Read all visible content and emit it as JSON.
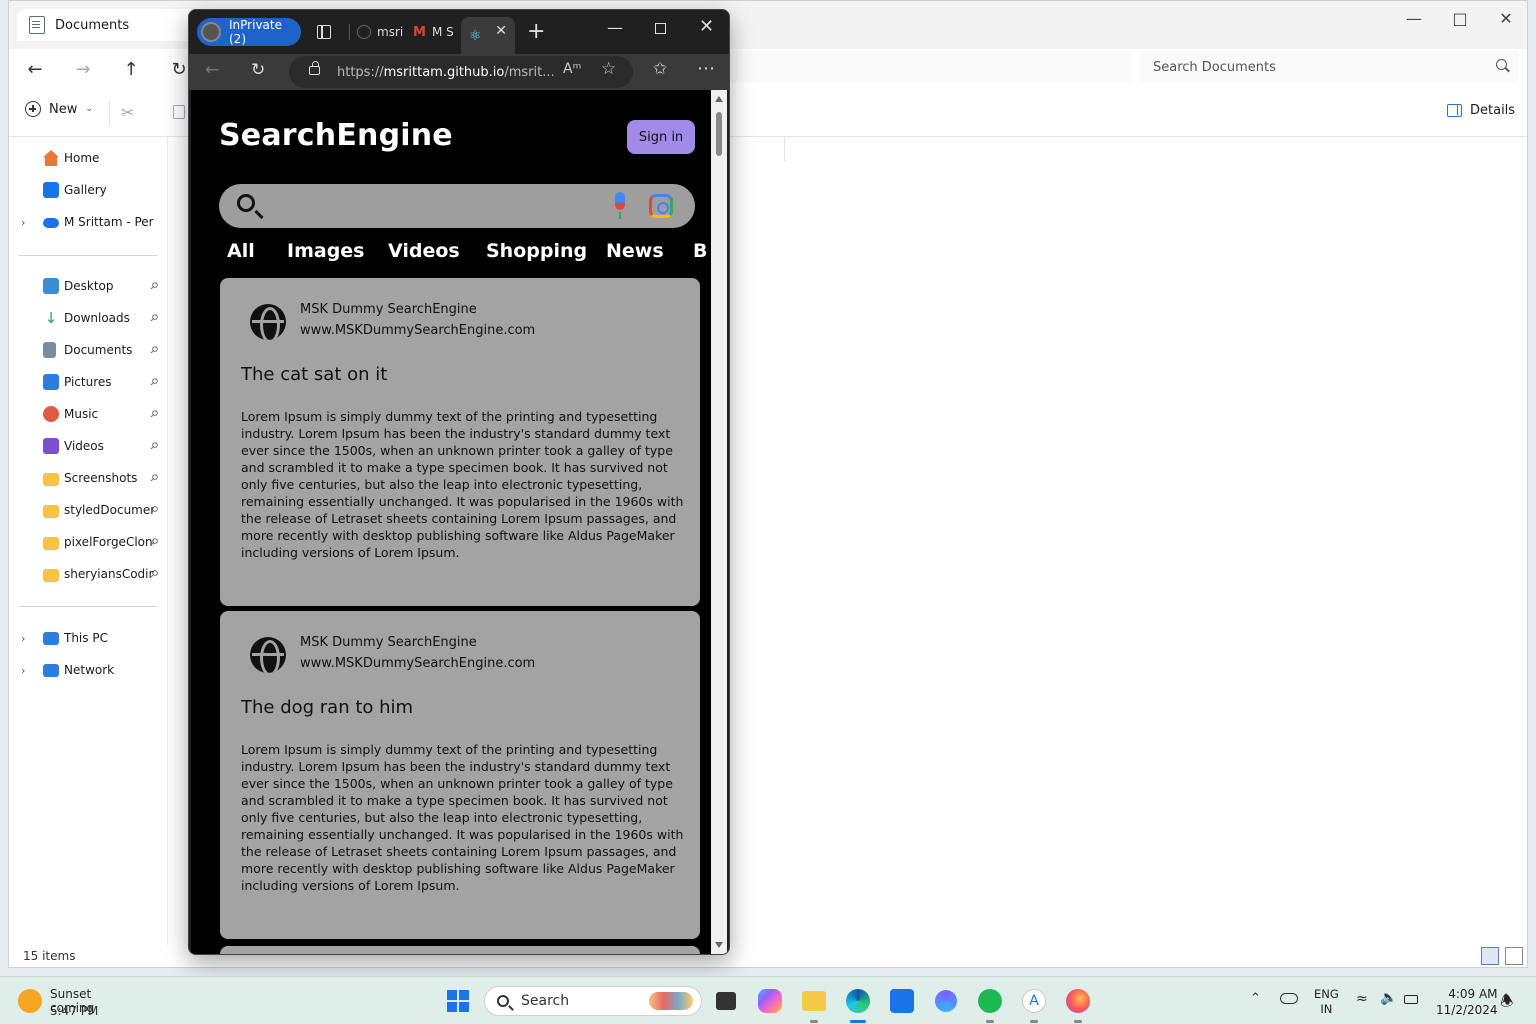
{
  "explorer": {
    "tab_title": "Documents",
    "search_placeholder": "Search Documents",
    "toolbar": {
      "new_label": "New",
      "details_label": "Details"
    },
    "sidebar": {
      "top": [
        {
          "label": "Home",
          "icon": "home-icon",
          "color": "#e8773c"
        },
        {
          "label": "Gallery",
          "icon": "gallery-icon",
          "color": "#1a73e8"
        },
        {
          "label": "M Srittam - Personal",
          "icon": "onedrive-icon",
          "color": "#1a73e8"
        }
      ],
      "pinned": [
        {
          "label": "Desktop",
          "icon": "desktop-icon",
          "color": "#3a8ed6"
        },
        {
          "label": "Downloads",
          "icon": "download-icon",
          "color": "#2e9e57"
        },
        {
          "label": "Documents",
          "icon": "documents-icon",
          "color": "#7a8ca0"
        },
        {
          "label": "Pictures",
          "icon": "pictures-icon",
          "color": "#2b7de0"
        },
        {
          "label": "Music",
          "icon": "music-icon",
          "color": "#e05a47"
        },
        {
          "label": "Videos",
          "icon": "videos-icon",
          "color": "#7a4fd0"
        },
        {
          "label": "Screenshots",
          "icon": "folder-icon",
          "color": "#f5c542"
        },
        {
          "label": "styledDocument",
          "icon": "folder-icon",
          "color": "#f5c542"
        },
        {
          "label": "pixelForgeCloning",
          "icon": "folder-icon",
          "color": "#f5c542"
        },
        {
          "label": "sheryiansCoding",
          "icon": "folder-icon",
          "color": "#f5c542"
        }
      ],
      "bottom": [
        {
          "label": "This PC",
          "icon": "pc-icon",
          "color": "#2b7de0"
        },
        {
          "label": "Network",
          "icon": "network-icon",
          "color": "#2b7de0"
        }
      ]
    },
    "status": "15 items"
  },
  "browser": {
    "inprivate_label": "InPrivate (2)",
    "tabs": [
      {
        "label": "msri",
        "icon": "github-icon"
      },
      {
        "label": "M S",
        "icon": "gmail-icon"
      },
      {
        "label": "",
        "icon": "react-icon"
      }
    ],
    "url_prefix": "https://",
    "url_host": "msrittam.github.io",
    "url_rest": "/msrit...",
    "page": {
      "logo": "SearchEngine",
      "signin_label": "Sign in",
      "categories": [
        "All",
        "Images",
        "Videos",
        "Shopping",
        "News",
        "B"
      ],
      "results": [
        {
          "site": "MSK Dummy SearchEngine",
          "url": "www.MSKDummySearchEngine.com",
          "title": "The cat sat on it",
          "body": "Lorem Ipsum is simply dummy text of the printing and typesetting industry. Lorem Ipsum has been the industry's standard dummy text ever since the 1500s, when an unknown printer took a galley of type and scrambled it to make a type specimen book. It has survived not only five centuries, but also the leap into electronic typesetting, remaining essentially unchanged. It was popularised in the 1960s with the release of Letraset sheets containing Lorem Ipsum passages, and more recently with desktop publishing software like Aldus PageMaker including versions of Lorem Ipsum."
        },
        {
          "site": "MSK Dummy SearchEngine",
          "url": "www.MSKDummySearchEngine.com",
          "title": "The dog ran to him",
          "body": "Lorem Ipsum is simply dummy text of the printing and typesetting industry. Lorem Ipsum has been the industry's standard dummy text ever since the 1500s, when an unknown printer took a galley of type and scrambled it to make a type specimen book. It has survived not only five centuries, but also the leap into electronic typesetting, remaining essentially unchanged. It was popularised in the 1960s with the release of Letraset sheets containing Lorem Ipsum passages, and more recently with desktop publishing software like Aldus PageMaker including versions of Lorem Ipsum."
        }
      ]
    }
  },
  "taskbar": {
    "weather_title": "Sunset coming",
    "weather_time": "5:47 PM",
    "search_label": "Search",
    "lang_line1": "ENG",
    "lang_line2": "IN",
    "time": "4:09 AM",
    "date": "11/2/2024"
  }
}
